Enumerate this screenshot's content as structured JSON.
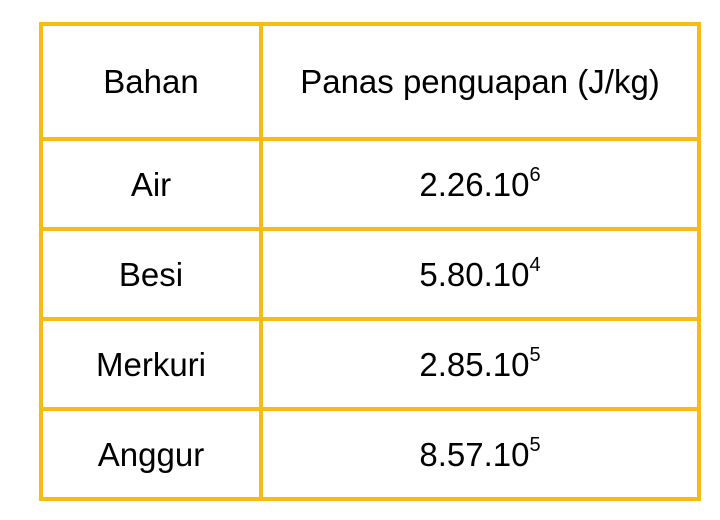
{
  "table": {
    "headers": [
      "Bahan",
      "Panas penguapan (J/kg)"
    ],
    "rows": [
      {
        "material": "Air",
        "mantissa": "2.26.10",
        "exponent": "6"
      },
      {
        "material": "Besi",
        "mantissa": "5.80.10",
        "exponent": "4"
      },
      {
        "material": "Merkuri",
        "mantissa": "2.85.10",
        "exponent": "5"
      },
      {
        "material": "Anggur",
        "mantissa": "8.57.10",
        "exponent": "5"
      }
    ],
    "border_color": "#f6bc13"
  }
}
